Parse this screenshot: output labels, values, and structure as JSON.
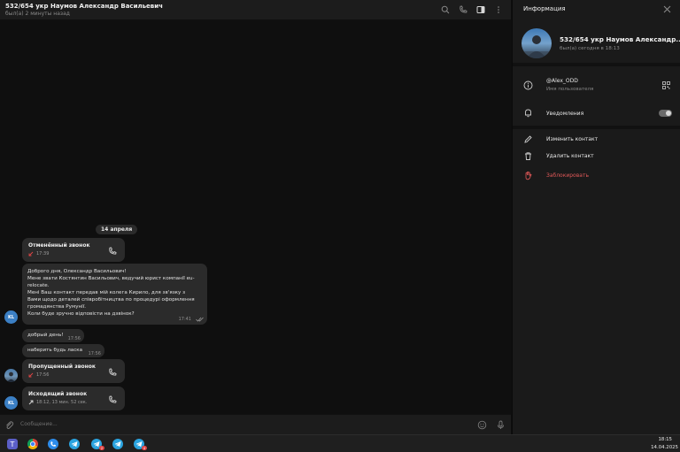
{
  "chat": {
    "title": "532/654 укр Наумов Александр Васильевич",
    "status": "был(а) 2 минуты назад"
  },
  "header_icons": [
    "search-icon",
    "phone-icon",
    "sidebar-toggle-icon",
    "more-vert-icon"
  ],
  "messages": {
    "date_separator": "14 апреля",
    "cancelled_call": {
      "title": "Отменённый звонок",
      "time": "17:39"
    },
    "long_message": {
      "lines": [
        "Доброго дня, Олександр Васильович!",
        "Мене звати Костянтин Васильович, ведучий юрист компанії eu-",
        "relocate.",
        "Мені Ваш контакт передав мій колега Кирило, для зв'язку з",
        "Вами щодо деталей співробітництва по процедурі оформлення",
        "громадянства Румунії.",
        "Коли буде зручно відповісти на дзвінок?"
      ],
      "time": "17:41"
    },
    "reply_1": {
      "text": "добрый день!",
      "time": "17:56"
    },
    "reply_2": {
      "text": "наберить будь ласка",
      "time": "17:56"
    },
    "missed_call": {
      "title": "Пропущенный звонок",
      "time": "17:56"
    },
    "outgoing_call": {
      "title": "Исходящий звонок",
      "meta": "18:12, 13 мин. 52 сек."
    },
    "avatar_initials": "KL"
  },
  "composer": {
    "placeholder": "Сообщение..."
  },
  "info_panel": {
    "title": "Информация",
    "profile_name": "532/654 укр Наумов Александр...",
    "profile_status": "был(а) сегодня в 18:13",
    "username": "@Alex_ODD",
    "username_caption": "Имя пользователя",
    "notifications_label": "Уведомления",
    "notifications_on": true,
    "edit_contact": "Изменить контакт",
    "delete_contact": "Удалить контакт",
    "block": "Заблокировать"
  },
  "taskbar": {
    "apps": [
      "teams-icon",
      "chrome-icon",
      "app-icon",
      "telegram-icon",
      "telegram-icon",
      "telegram-icon",
      "telegram-icon"
    ],
    "badges": [
      "",
      "",
      "",
      "",
      "2",
      "",
      "4"
    ],
    "time": "18:15",
    "date": "14.04.2025"
  },
  "colors": {
    "accent": "#3b7fc4",
    "danger": "#e05858",
    "bubble": "#2b2b2b",
    "panel": "#1a1a1a"
  }
}
